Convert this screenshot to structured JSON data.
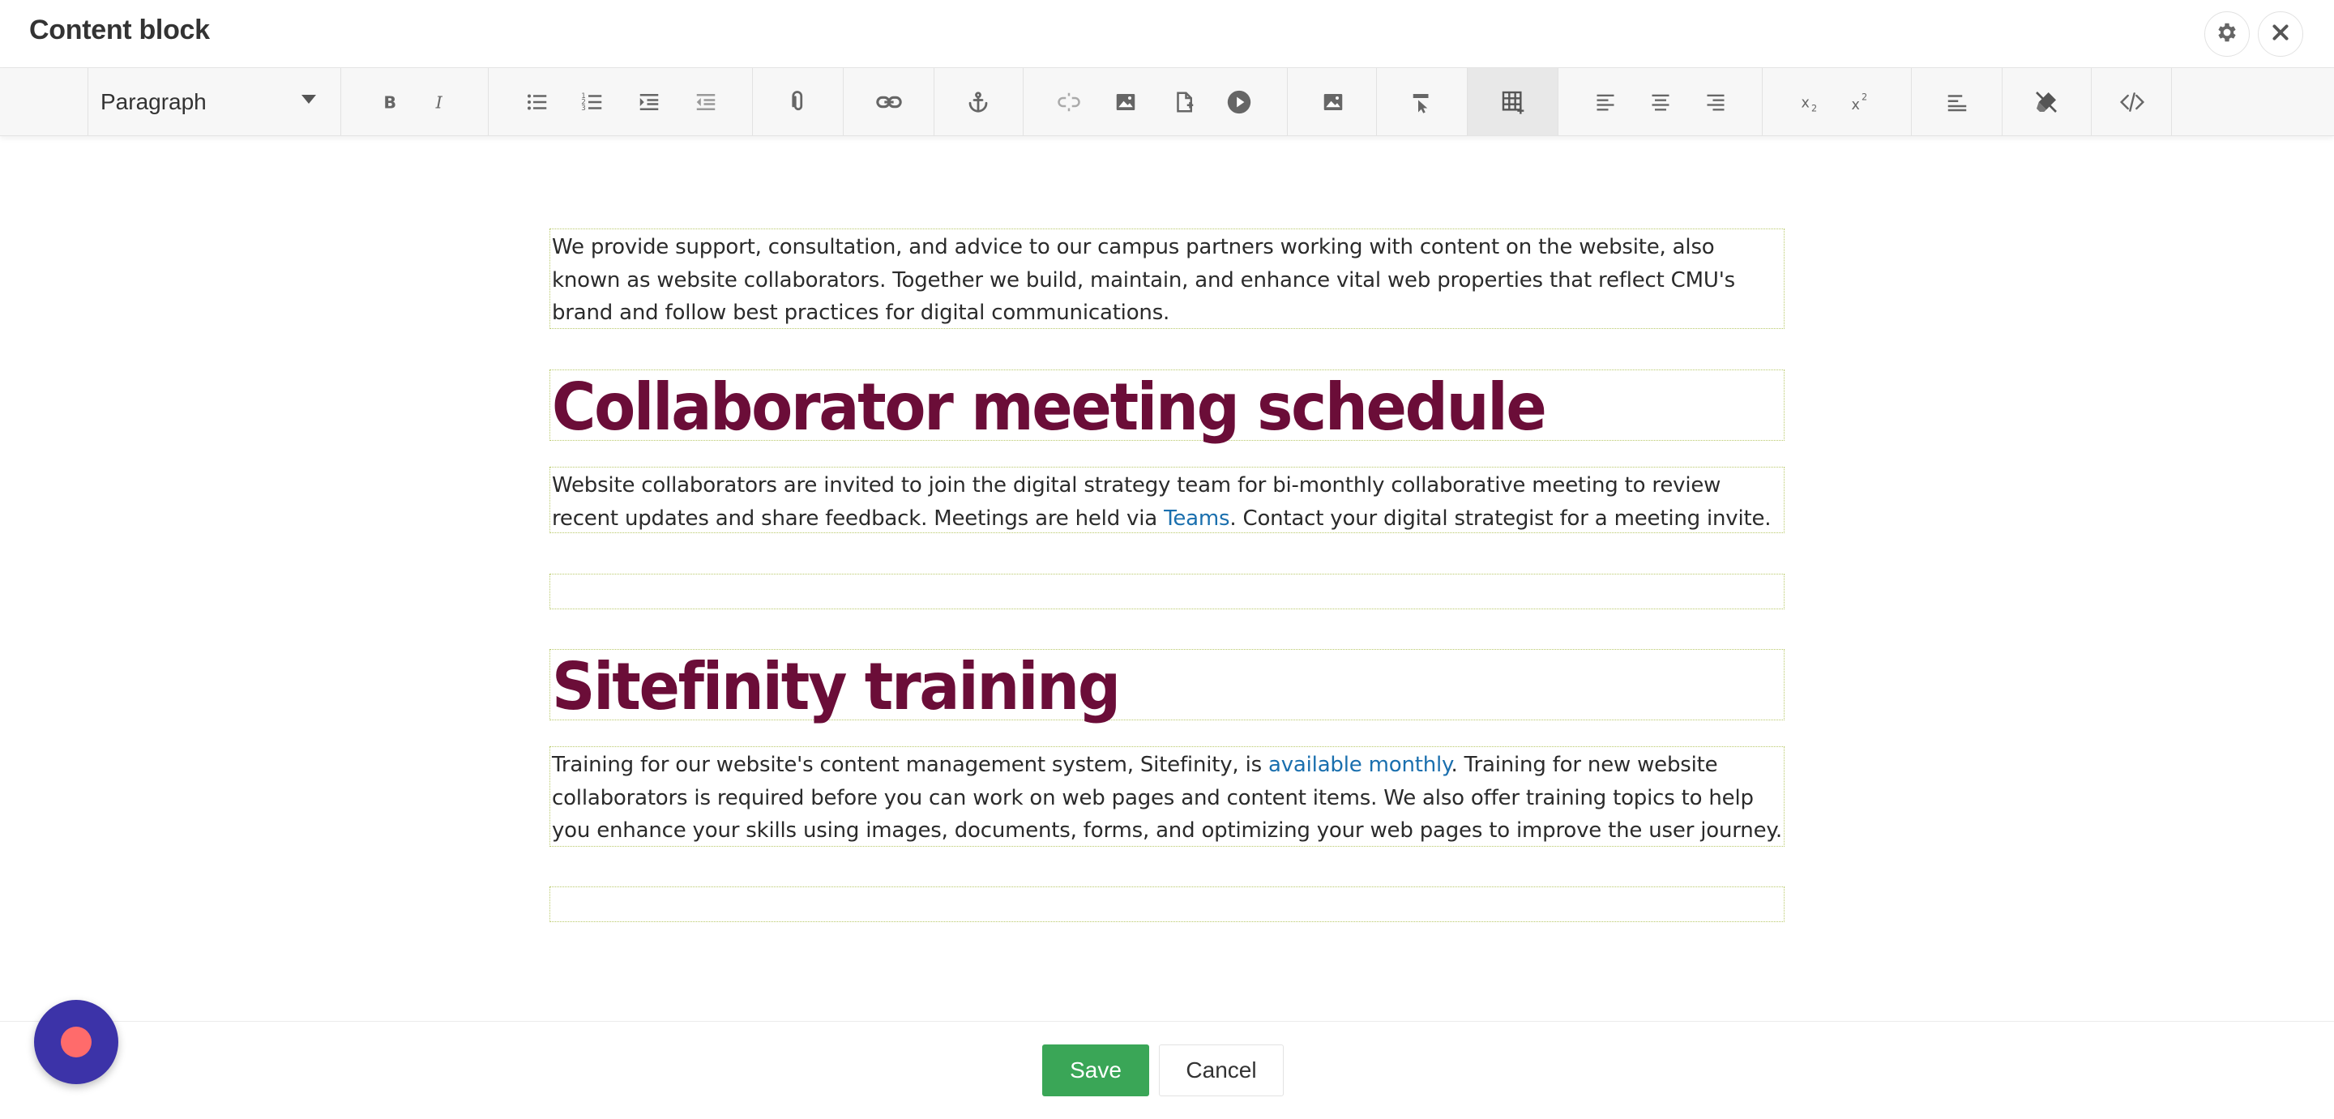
{
  "window": {
    "title": "Content block",
    "settings_icon": "gear-icon",
    "close_icon": "close-icon"
  },
  "toolbar": {
    "format_select": {
      "value": "Paragraph",
      "icon": "chevron-down-icon"
    },
    "buttons": [
      {
        "name": "bold",
        "icon": "bold-icon"
      },
      {
        "name": "italic",
        "icon": "italic-icon"
      },
      {
        "name": "bullet-list",
        "icon": "bullet-list-icon"
      },
      {
        "name": "numbered-list",
        "icon": "numbered-list-icon"
      },
      {
        "name": "indent",
        "icon": "indent-icon"
      },
      {
        "name": "outdent",
        "icon": "outdent-icon"
      },
      {
        "name": "paperclip",
        "icon": "paperclip-icon"
      },
      {
        "name": "link",
        "icon": "link-icon"
      },
      {
        "name": "anchor",
        "icon": "anchor-icon"
      },
      {
        "name": "unlink",
        "icon": "unlink-icon"
      },
      {
        "name": "image",
        "icon": "image-icon"
      },
      {
        "name": "document",
        "icon": "document-icon"
      },
      {
        "name": "video",
        "icon": "play-icon"
      },
      {
        "name": "image-gallery",
        "icon": "image-icon"
      },
      {
        "name": "format-painter",
        "icon": "pointer-icon"
      },
      {
        "name": "table",
        "icon": "table-icon"
      },
      {
        "name": "align-left",
        "icon": "align-left-icon"
      },
      {
        "name": "align-center",
        "icon": "align-center-icon"
      },
      {
        "name": "align-right",
        "icon": "align-right-icon"
      },
      {
        "name": "subscript",
        "icon": "subscript-icon"
      },
      {
        "name": "superscript",
        "icon": "superscript-icon"
      },
      {
        "name": "paragraph-format",
        "icon": "text-lines-icon"
      },
      {
        "name": "clear-formatting",
        "icon": "eraser-icon"
      },
      {
        "name": "html-view",
        "icon": "code-icon"
      }
    ]
  },
  "content": {
    "intro": "We provide support, consultation, and advice to our campus partners working with content on the website, also known as website collaborators. Together we build, maintain, and enhance vital web properties that reflect CMU's brand and follow best practices for digital communications.",
    "heading1": "Collaborator meeting schedule",
    "meeting_before": "Website collaborators are invited to join the digital strategy team for bi-monthly collaborative meeting to review recent updates and share feedback. Meetings are held via ",
    "meeting_link": "Teams",
    "meeting_after": ". Contact your digital strategist for a meeting invite.",
    "heading2": "Sitefinity training",
    "training_before": "Training for our website's content management system, Sitefinity, is ",
    "training_link": "available monthly",
    "training_after": ". Training for new website collaborators is required before you can work on web pages and content items. We also offer training topics to help you enhance your skills using images, documents, forms, and optimizing your web pages to improve the user journey."
  },
  "footer": {
    "save_label": "Save",
    "cancel_label": "Cancel"
  },
  "colors": {
    "heading": "#6b0d38",
    "link": "#1a6fae",
    "save": "#3aa657",
    "recorder": "#3c33a8",
    "recorder_dot": "#ff6b6b"
  }
}
